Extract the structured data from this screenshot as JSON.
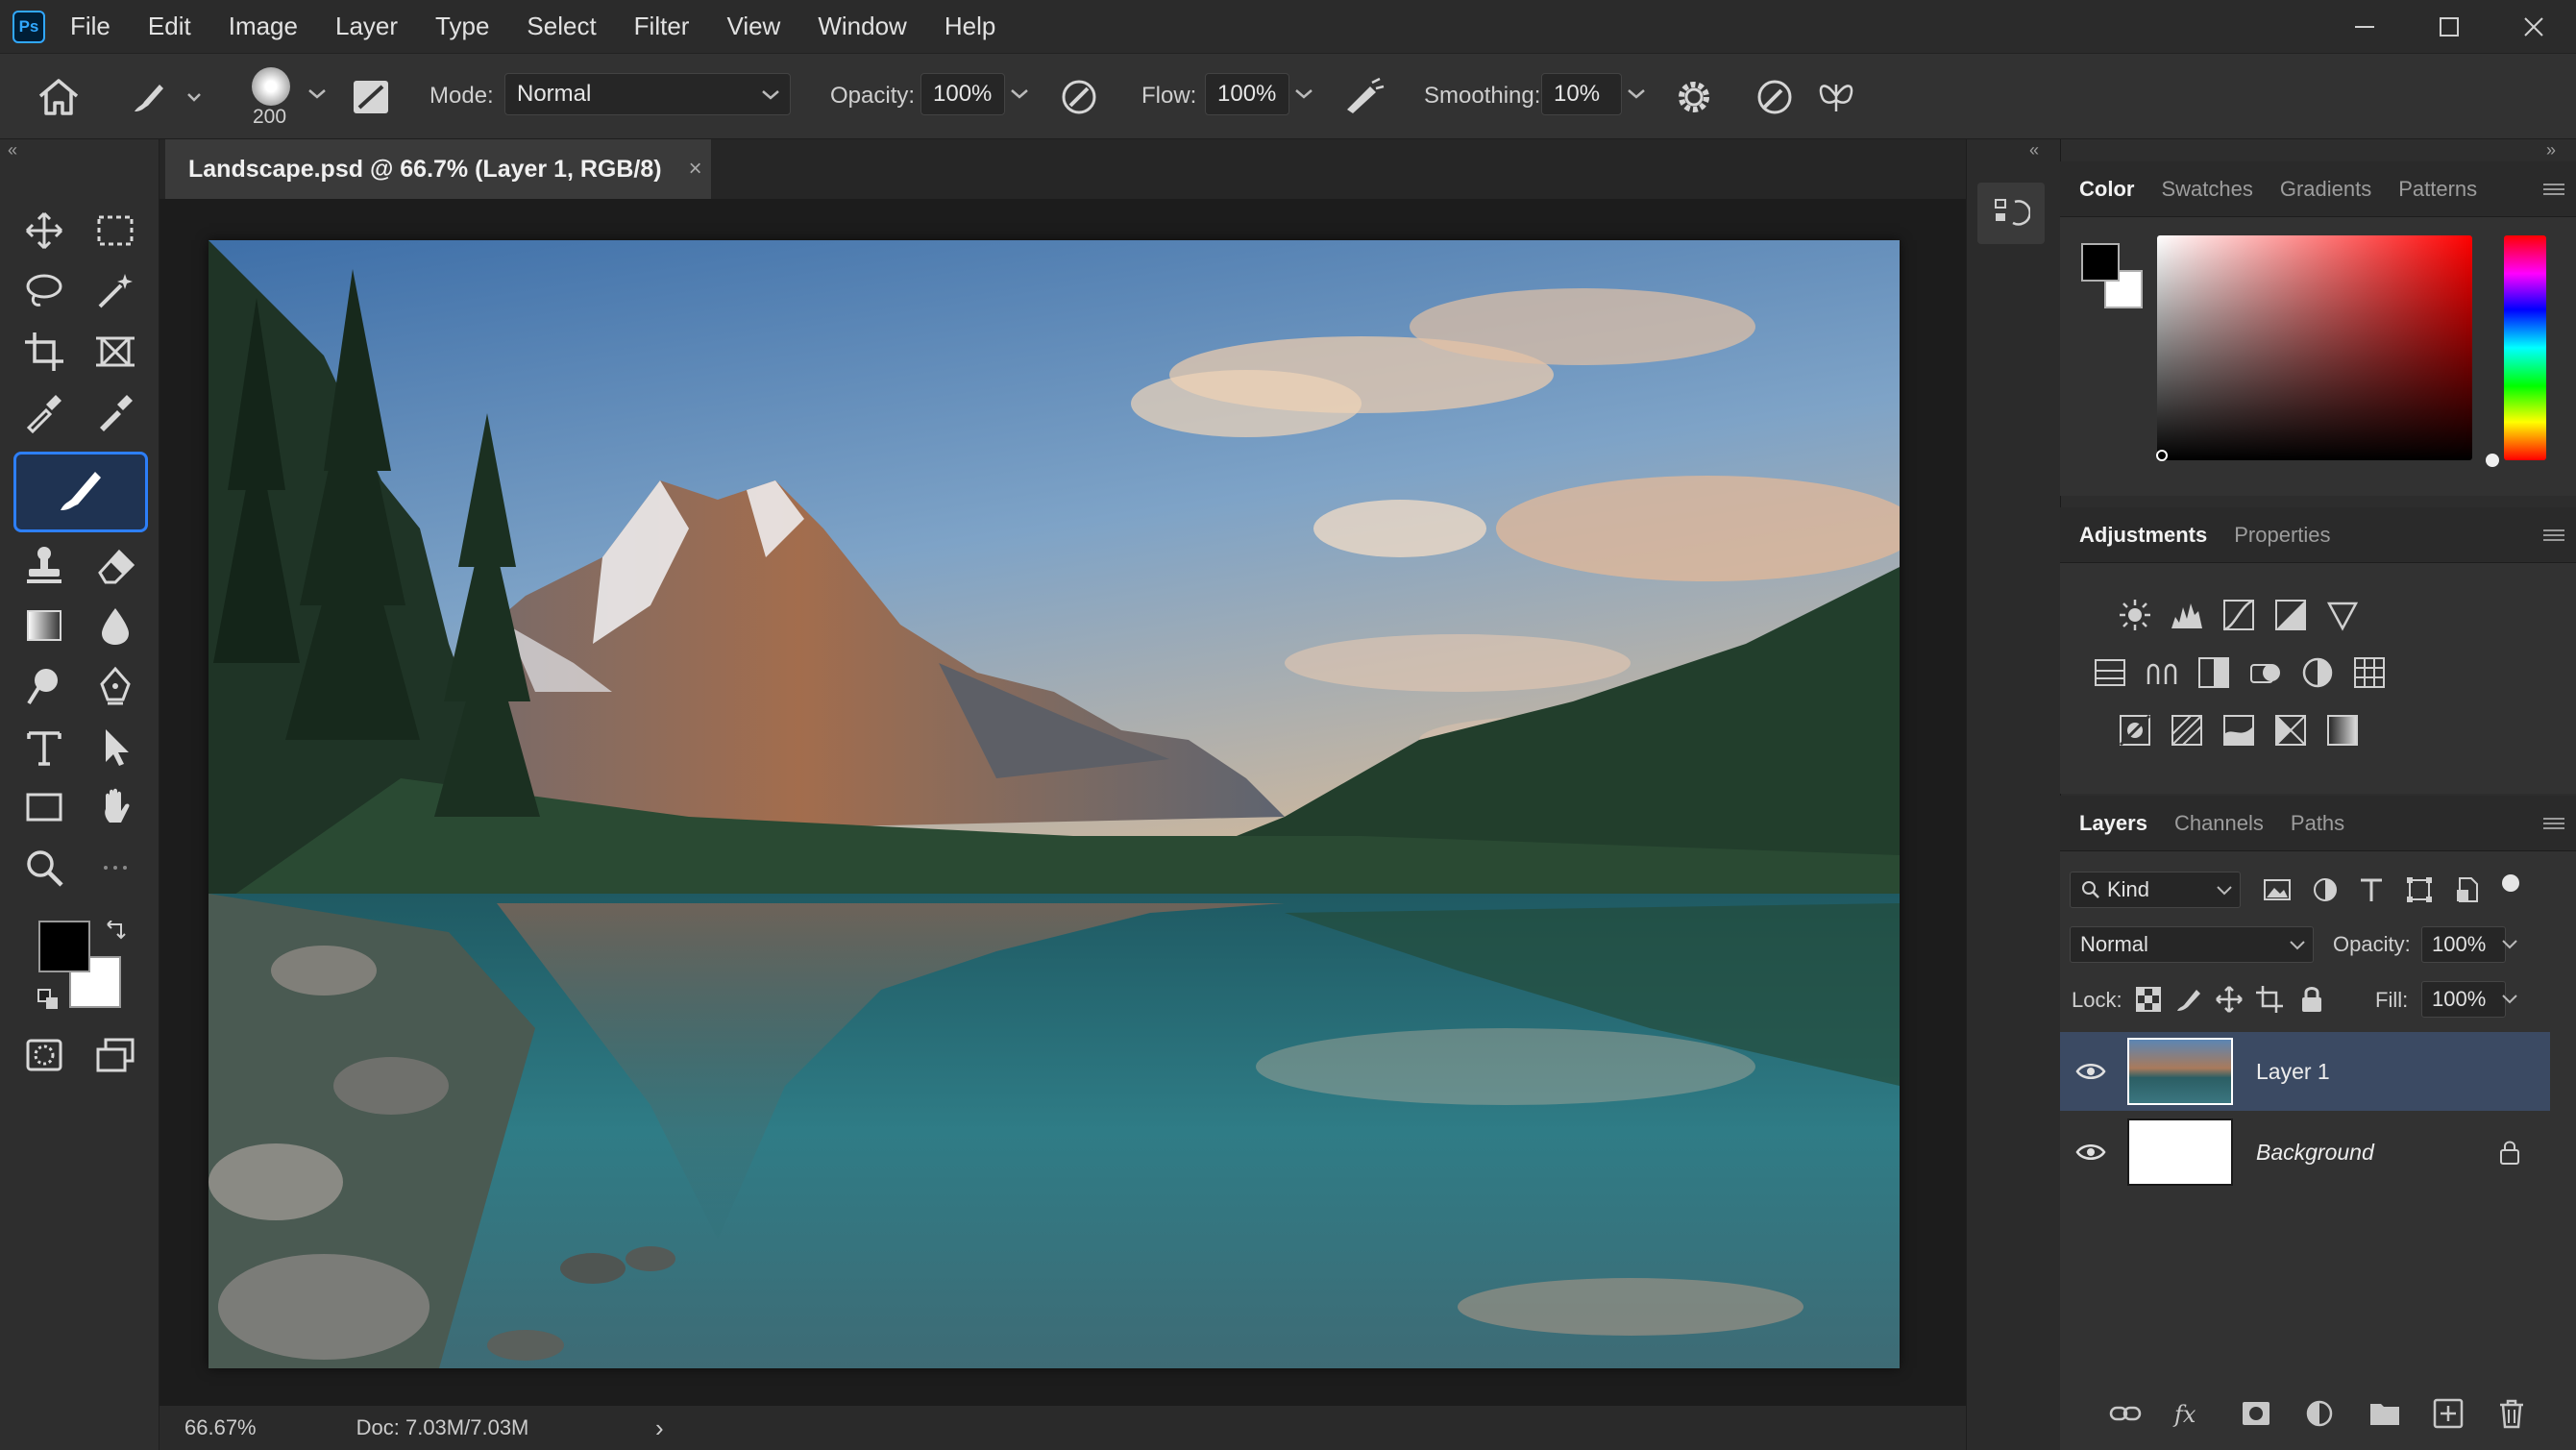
{
  "app": {
    "logo": "Ps"
  },
  "menu": [
    "File",
    "Edit",
    "Image",
    "Layer",
    "Type",
    "Select",
    "Filter",
    "View",
    "Window",
    "Help"
  ],
  "options_bar": {
    "brush_size": "200",
    "mode_label": "Mode:",
    "mode_value": "Normal",
    "opacity_label": "Opacity:",
    "opacity_value": "100%",
    "flow_label": "Flow:",
    "flow_value": "100%",
    "smoothing_label": "Smoothing:",
    "smoothing_value": "10%"
  },
  "document": {
    "tab_title": "Landscape.psd @ 66.7% (Layer 1, RGB/8)",
    "close_glyph": "×",
    "image": "mountain-lake-landscape"
  },
  "status": {
    "zoom": "66.67%",
    "doc_info": "Doc: 7.03M/7.03M",
    "arrow": "›"
  },
  "color_panel": {
    "tabs": [
      "Color",
      "Swatches",
      "Gradients",
      "Patterns"
    ],
    "foreground": "#000000",
    "background": "#ffffff"
  },
  "adjust_panel": {
    "tabs": [
      "Adjustments",
      "Properties"
    ]
  },
  "layers_panel": {
    "tabs": [
      "Layers",
      "Channels",
      "Paths"
    ],
    "kind_filter": "Kind",
    "blend_mode": "Normal",
    "opacity_label": "Opacity:",
    "opacity_value": "100%",
    "lock_label": "Lock:",
    "fill_label": "Fill:",
    "fill_value": "100%",
    "layers": [
      {
        "name": "Layer 1",
        "selected": true
      },
      {
        "name": "Background",
        "locked": true
      }
    ]
  },
  "colors": {
    "accent": "#2d7ff9",
    "selected_layer": "#3b4a63"
  }
}
